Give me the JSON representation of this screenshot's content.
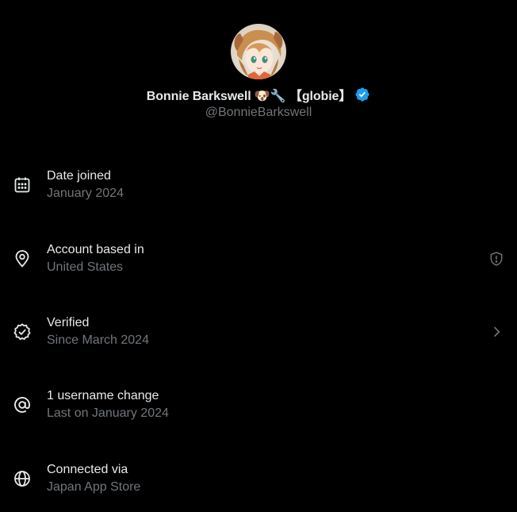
{
  "profile": {
    "display_name": "Bonnie Barkswell",
    "name_emoji": "🐶🔧",
    "name_tag": "【globie】",
    "handle": "@BonnieBarkswell",
    "verified_color": "#1d9bf0"
  },
  "items": [
    {
      "icon": "calendar-icon",
      "title": "Date joined",
      "subtitle": "January 2024",
      "trailing": ""
    },
    {
      "icon": "location-pin-icon",
      "title": "Account based in",
      "subtitle": "United States",
      "trailing": "shield-alert-icon"
    },
    {
      "icon": "verified-check-icon",
      "title": "Verified",
      "subtitle": "Since March 2024",
      "trailing": "chevron-right-icon"
    },
    {
      "icon": "at-sign-icon",
      "title": "1 username change",
      "subtitle": "Last on January 2024",
      "trailing": ""
    },
    {
      "icon": "globe-icon",
      "title": "Connected via",
      "subtitle": "Japan App Store",
      "trailing": ""
    }
  ],
  "colors": {
    "background": "#000000",
    "primary_text": "#e7e9ea",
    "secondary_text": "#71767b",
    "accent": "#1d9bf0"
  }
}
